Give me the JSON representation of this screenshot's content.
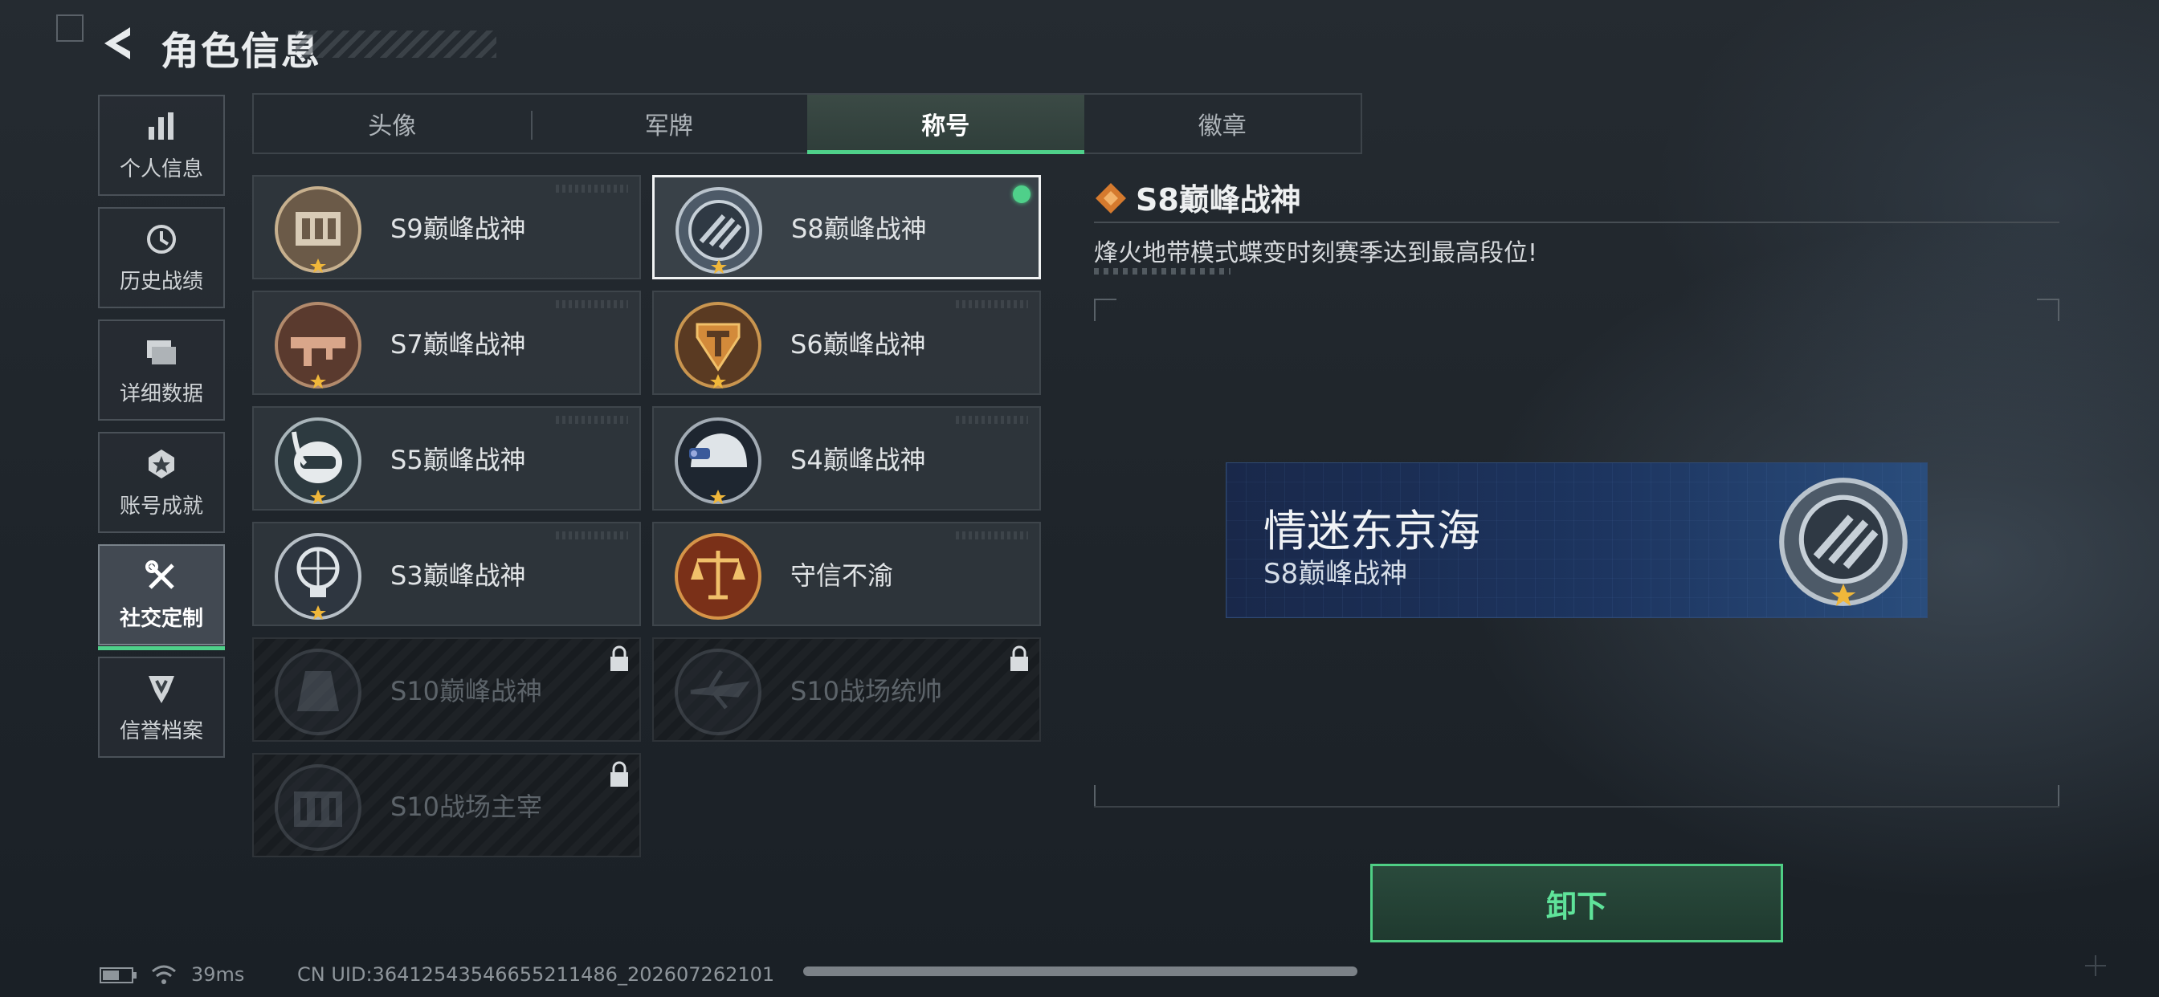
{
  "header": {
    "title": "角色信息"
  },
  "sidebar": {
    "items": [
      {
        "label": "个人信息",
        "icon": "bar-chart-icon"
      },
      {
        "label": "历史战绩",
        "icon": "history-icon"
      },
      {
        "label": "详细数据",
        "icon": "folder-icon"
      },
      {
        "label": "账号成就",
        "icon": "achievement-icon"
      },
      {
        "label": "社交定制",
        "icon": "tools-icon",
        "active": true
      },
      {
        "label": "信誉档案",
        "icon": "credibility-icon"
      }
    ]
  },
  "tabs": [
    {
      "label": "头像"
    },
    {
      "label": "军牌"
    },
    {
      "label": "称号",
      "active": true
    },
    {
      "label": "徽章"
    }
  ],
  "titles": [
    {
      "label": "S9巅峰战神",
      "locked": false
    },
    {
      "label": "S8巅峰战神",
      "locked": false,
      "selected": true
    },
    {
      "label": "S7巅峰战神",
      "locked": false
    },
    {
      "label": "S6巅峰战神",
      "locked": false
    },
    {
      "label": "S5巅峰战神",
      "locked": false
    },
    {
      "label": "S4巅峰战神",
      "locked": false
    },
    {
      "label": "S3巅峰战神",
      "locked": false
    },
    {
      "label": "守信不渝",
      "locked": false
    },
    {
      "label": "S10巅峰战神",
      "locked": true
    },
    {
      "label": "S10战场统帅",
      "locked": true
    },
    {
      "label": "S10战场主宰",
      "locked": true
    }
  ],
  "detail": {
    "title": "S8巅峰战神",
    "description": "烽火地带模式蝶变时刻赛季达到最高段位!",
    "preview": {
      "name": "情迷东京海",
      "title": "S8巅峰战神"
    },
    "button_label": "卸下"
  },
  "status": {
    "ping": "39ms",
    "uid": "CN UID:364125435466552114​86_202607262101"
  },
  "colors": {
    "accent": "#4fd08a",
    "nameplate": "#1d3560"
  }
}
